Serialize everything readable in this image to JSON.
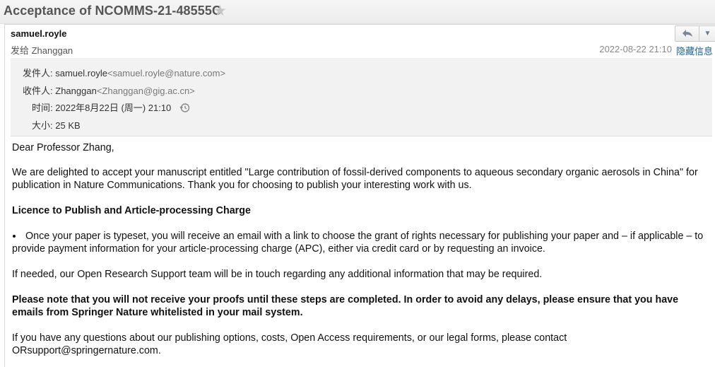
{
  "window": {
    "subject": "Acceptance of NCOMMS-21-48555C"
  },
  "header": {
    "sender": "samuel.royle",
    "sent_to": "发给 Zhanggan",
    "datetime": "2022-08-22 21:10",
    "hide_details": "隐藏信息"
  },
  "details": {
    "from_label": "发件人:",
    "from_name": "samuel.royle",
    "from_addr": "<samuel.royle@nature.com>",
    "to_label": "收件人:",
    "to_name": "Zhanggan",
    "to_addr": "<Zhanggan@gig.ac.cn>",
    "time_label": "时间:",
    "time_value": "2022年8月22日 (周一) 21:10",
    "size_label": "大小:",
    "size_value": "25 KB"
  },
  "body": {
    "greeting": "Dear Professor Zhang,",
    "p1": "We are delighted to accept your manuscript entitled \"Large contribution of fossil-derived components to aqueous secondary organic aerosols in China\" for publication in Nature Communications. Thank you for choosing to publish your interesting work with us.",
    "heading": "Licence to Publish and Article-processing Charge",
    "bullet": "Once your paper is typeset, you will receive an email with a link to choose the grant of rights necessary for publishing your paper and – if applicable – to provide payment information for your article-processing charge (APC), either via credit card or by requesting an invoice.",
    "p2": "If needed, our Open Research Support team will be in touch regarding any additional information that may be required.",
    "p3": "Please note that you will not receive your proofs until these steps are completed. In order to avoid any delays, please ensure that you have emails from Springer Nature whitelisted in your mail system.",
    "p4": "If you have any questions about our publishing options, costs, Open Access requirements, or our legal forms, please contact ORsupport@springernature.com."
  }
}
